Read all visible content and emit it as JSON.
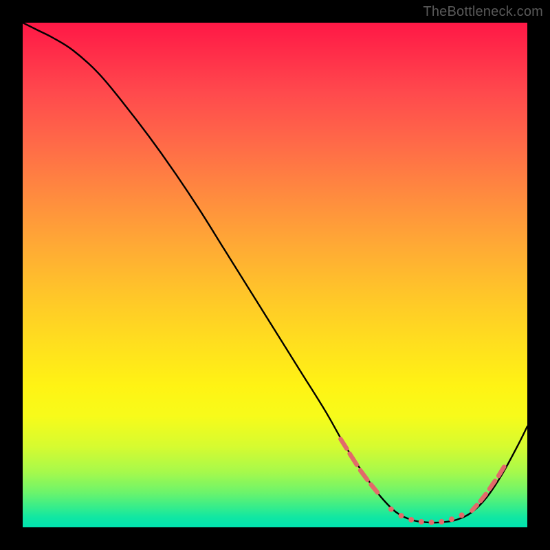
{
  "watermark": "TheBottleneck.com",
  "chart_data": {
    "type": "line",
    "title": "",
    "xlabel": "",
    "ylabel": "",
    "xlim": [
      0,
      100
    ],
    "ylim": [
      0,
      100
    ],
    "grid": false,
    "series": [
      {
        "name": "curve",
        "x": [
          0,
          3,
          6,
          10,
          15,
          20,
          25,
          30,
          35,
          40,
          45,
          50,
          55,
          60,
          64,
          68,
          71,
          74,
          77,
          80,
          83,
          86,
          89,
          92,
          95,
          98,
          100
        ],
        "y": [
          100,
          98.5,
          97,
          94.5,
          90,
          84,
          77.5,
          70.5,
          63,
          55,
          47,
          39,
          31,
          23,
          16,
          10,
          6,
          3,
          1.5,
          1,
          1,
          1.5,
          3,
          6,
          10.5,
          16,
          20
        ],
        "stroke": "#000000",
        "stroke_width": 2.4
      }
    ],
    "markers": [
      {
        "kind": "dash",
        "x1": 63.0,
        "y1": 17.5,
        "x2": 64.2,
        "y2": 15.6
      },
      {
        "kind": "dash",
        "x1": 64.8,
        "y1": 14.6,
        "x2": 66.2,
        "y2": 12.4
      },
      {
        "kind": "dash",
        "x1": 66.9,
        "y1": 11.3,
        "x2": 68.3,
        "y2": 9.4
      },
      {
        "kind": "dash",
        "x1": 69.0,
        "y1": 8.5,
        "x2": 70.3,
        "y2": 6.9
      },
      {
        "kind": "dot",
        "cx": 73.0,
        "cy": 3.6
      },
      {
        "kind": "dot",
        "cx": 75.0,
        "cy": 2.3
      },
      {
        "kind": "dot",
        "cx": 77.0,
        "cy": 1.5
      },
      {
        "kind": "dot",
        "cx": 79.0,
        "cy": 1.1
      },
      {
        "kind": "dot",
        "cx": 81.0,
        "cy": 1.0
      },
      {
        "kind": "dot",
        "cx": 83.0,
        "cy": 1.1
      },
      {
        "kind": "dot",
        "cx": 85.0,
        "cy": 1.6
      },
      {
        "kind": "dot",
        "cx": 87.0,
        "cy": 2.4
      },
      {
        "kind": "dash",
        "x1": 89.0,
        "y1": 3.3,
        "x2": 90.0,
        "y2": 4.4
      },
      {
        "kind": "dash",
        "x1": 90.7,
        "y1": 5.2,
        "x2": 91.8,
        "y2": 6.6
      },
      {
        "kind": "dash",
        "x1": 92.5,
        "y1": 7.6,
        "x2": 93.6,
        "y2": 9.2
      },
      {
        "kind": "dash",
        "x1": 94.3,
        "y1": 10.2,
        "x2": 95.4,
        "y2": 12.0
      }
    ],
    "marker_style": {
      "color": "#e26a6a",
      "dot_r": 4.0,
      "dash_w": 6.5
    }
  }
}
